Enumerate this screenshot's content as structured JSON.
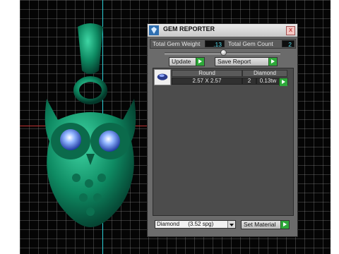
{
  "window": {
    "title": "GEM REPORTER",
    "close_label": "x"
  },
  "summary": {
    "weight_label": "Total Gem Weight",
    "weight_value": ".13",
    "count_label": "Total Gem Count",
    "count_value": "2"
  },
  "toolbar": {
    "update_label": "Update",
    "save_label": "Save Report"
  },
  "gem_table": {
    "columns": [
      "Round",
      "Diamond"
    ],
    "rows": [
      {
        "size": "2.57 X 2.57",
        "count": "2",
        "weight": "0.13tw"
      }
    ]
  },
  "footer": {
    "material_selected": "Diamond",
    "material_gravity": "(3.52 spg)",
    "set_material_label": "Set Material"
  },
  "colors": {
    "model": "#0e7a5c",
    "value_text": "#55e0f0",
    "play_button": "#2ea83a"
  }
}
